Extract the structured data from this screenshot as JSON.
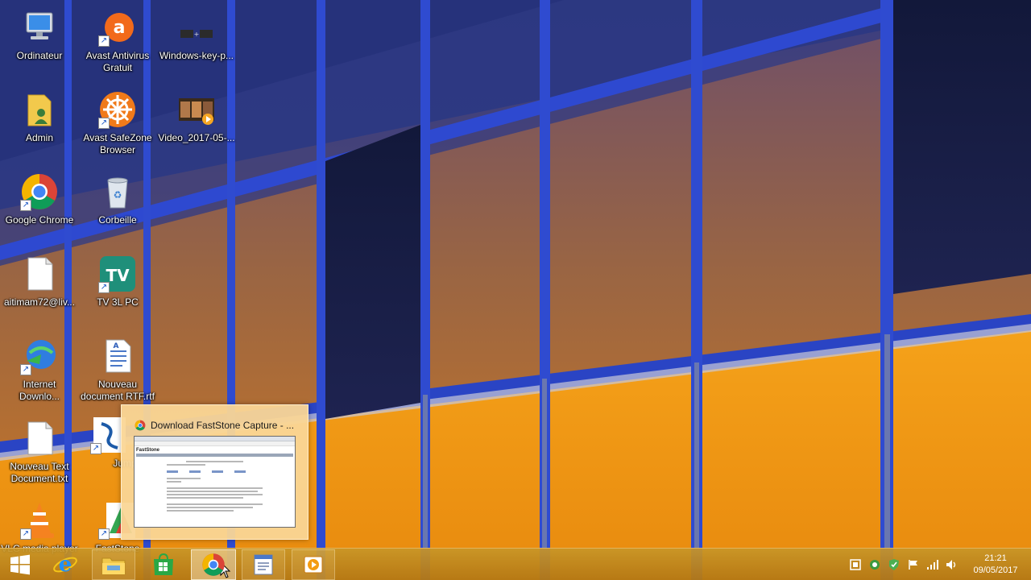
{
  "desktop": {
    "icons": [
      {
        "label": "Ordinateur",
        "icon": "computer-icon"
      },
      {
        "label": "Avast Antivirus\nGratuit",
        "icon": "avast-antivirus-icon"
      },
      {
        "label": "Windows-key-p...",
        "icon": "video-file-icon"
      },
      {
        "label": "Admin",
        "icon": "user-folder-icon"
      },
      {
        "label": "Avast SafeZone\nBrowser",
        "icon": "avast-safezone-icon"
      },
      {
        "label": "Video_2017-05-...",
        "icon": "video-file-icon"
      },
      {
        "label": "Google Chrome",
        "icon": "chrome-icon"
      },
      {
        "label": "Corbeille",
        "icon": "recycle-bin-icon"
      },
      {
        "label": "aitimam72@liv...",
        "icon": "text-file-icon"
      },
      {
        "label": "TV 3L PC",
        "icon": "tv3l-icon"
      },
      {
        "label": "Internet\nDownlo...",
        "icon": "internet-download-manager-icon"
      },
      {
        "label": "Nouveau\ndocument RTF.rtf",
        "icon": "rtf-document-icon"
      },
      {
        "label": "Nouveau Text\nDocument.txt",
        "icon": "text-file-icon"
      },
      {
        "label": "Jump",
        "icon": "jump-app-icon"
      },
      {
        "label": "VLC media player",
        "icon": "vlc-icon"
      },
      {
        "label": "FastStone",
        "icon": "faststone-icon"
      }
    ]
  },
  "preview": {
    "title": "Download FastStone Capture - ...",
    "thumb_brand": "FastStone"
  },
  "taskbar": {
    "buttons": [
      {
        "name": "start",
        "icon": "windows-start-icon"
      },
      {
        "name": "internet-explorer",
        "icon": "internet-explorer-icon"
      },
      {
        "name": "file-explorer",
        "icon": "file-explorer-icon"
      },
      {
        "name": "store",
        "icon": "windows-store-icon"
      },
      {
        "name": "google-chrome",
        "icon": "chrome-icon"
      },
      {
        "name": "wordpad",
        "icon": "wordpad-icon"
      },
      {
        "name": "media-player",
        "icon": "media-player-icon"
      }
    ],
    "tray_icons": [
      "filmstrip-icon",
      "network-share-icon",
      "update-shield-icon",
      "action-center-flag-icon",
      "signal-bars-icon",
      "volume-icon"
    ],
    "clock": {
      "time": "21:21",
      "date": "09/05/2017"
    }
  },
  "colors": {
    "taskbar": "#c8962a",
    "preview_bg": "#fad696",
    "wallpaper_frame": "#2a3fb0",
    "wallpaper_orange": "#f59a18"
  }
}
